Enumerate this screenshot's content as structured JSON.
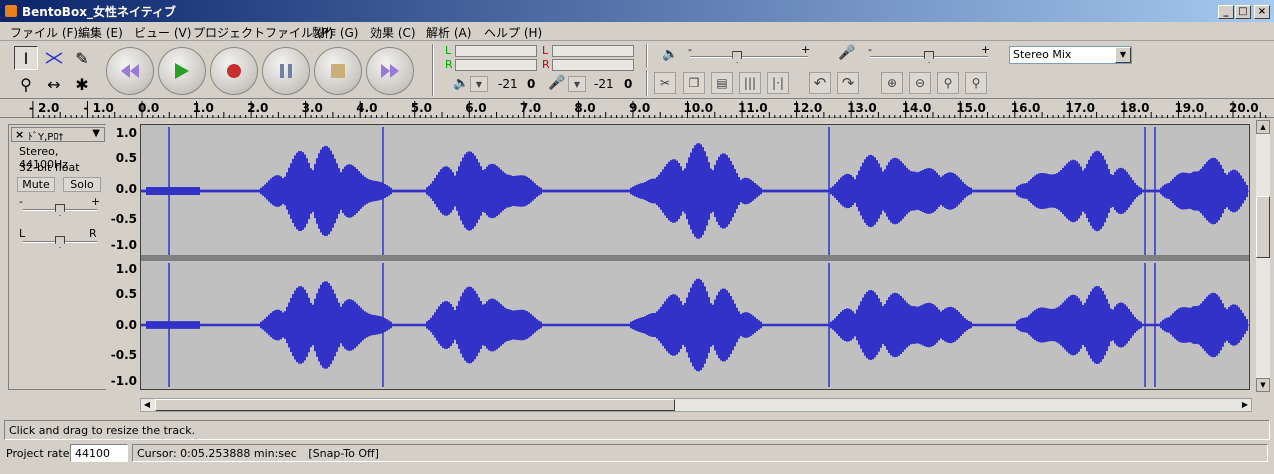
{
  "window": {
    "title": "BentoBox_女性ネイティブ",
    "min": "_",
    "max": "□",
    "close": "×"
  },
  "menu": [
    "ファイル (F)",
    "編集 (E)",
    "ビュー (V)",
    "プロジェクトファイル (P)",
    "製作 (G)",
    "効果 (C)",
    "解析 (A)",
    "ヘルプ (H)"
  ],
  "meters": {
    "left_label": "L",
    "right_label": "R",
    "play_db": "-21",
    "play_zero": "0",
    "rec_db": "-21",
    "rec_zero": "0"
  },
  "mixer": {
    "vol_min": "-",
    "vol_max": "+",
    "rec_min": "-",
    "rec_max": "+",
    "output_level": 0.4,
    "input_level": 0.5
  },
  "input_source": "Stereo Mix",
  "ruler": [
    "- 2.0",
    "- 1.0",
    "0.0",
    "1.0",
    "2.0",
    "3.0",
    "4.0",
    "5.0",
    "6.0",
    "7.0",
    "8.0",
    "9.0",
    "10.0",
    "11.0",
    "12.0",
    "13.0",
    "14.0",
    "15.0",
    "16.0",
    "17.0",
    "18.0",
    "19.0",
    "20.0"
  ],
  "track": {
    "name": "ﾄﾞY,Pﾛ†",
    "close": "×",
    "format": "Stereo, 44100Hz",
    "bits": "32-bit float",
    "mute": "Mute",
    "solo": "Solo",
    "gain_min": "-",
    "gain_max": "+",
    "pan_left": "L",
    "pan_right": "R",
    "gain_level": 0.5,
    "pan_level": 0.5
  },
  "scale": [
    "1.0",
    "0.5",
    "0.0",
    "-0.5",
    "-1.0"
  ],
  "status": "Click and drag to resize the track.",
  "project_rate_label": "Project rate:",
  "project_rate": "44100",
  "cursor": "Cursor: 0:05.253888 min:sec",
  "snap": "[Snap-To Off]",
  "colors": {
    "waveform": "#3232c8",
    "wave_bg": "#c0c0c0",
    "title_start": "#0a246a",
    "title_end": "#a6caf0"
  }
}
